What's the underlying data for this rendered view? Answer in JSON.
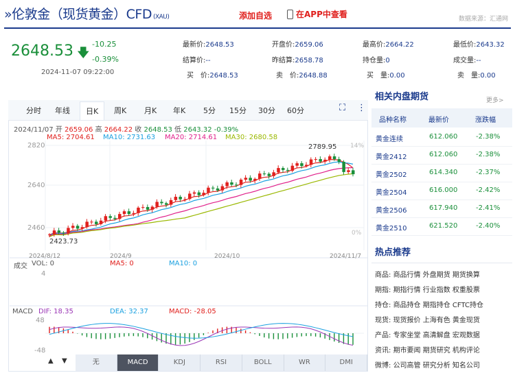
{
  "header": {
    "title": "»伦敦金（现货黄金）CFD",
    "title_suffix": "(XAU)",
    "add_favorite": "添加自选",
    "view_in_app": "在APP中查看",
    "source": "数据来源：汇通网"
  },
  "quote": {
    "price": "2648.53",
    "change": "-10.25",
    "change_pct": "-0.39%",
    "datetime": "2024-11-07 09:22:00",
    "fields": [
      {
        "label": "最新价:",
        "value": "2648.53"
      },
      {
        "label": "开盘价:",
        "value": "2659.06"
      },
      {
        "label": "最高价:",
        "value": "2664.22"
      },
      {
        "label": "最低价:",
        "value": "2643.32"
      },
      {
        "label": "结算价:",
        "value": "--"
      },
      {
        "label": "昨结算:",
        "value": "2658.78"
      },
      {
        "label": "持仓量:",
        "value": "0"
      },
      {
        "label": "成交量:",
        "value": "--"
      },
      {
        "label": "买　价:",
        "value": "2648.53"
      },
      {
        "label": "卖　价:",
        "value": "2648.88"
      },
      {
        "label": "买　量:",
        "value": "0.00"
      },
      {
        "label": "卖　量:",
        "value": "0.00"
      }
    ]
  },
  "chart_tabs": [
    "分时",
    "年线",
    "日K",
    "周K",
    "月K",
    "年K",
    "5分",
    "15分",
    "30分",
    "60分"
  ],
  "chart_info": {
    "date": "2024/11/07",
    "open_label": "开",
    "open": "2659.06",
    "high_label": "高",
    "high": "2664.22",
    "close_label": "收",
    "close": "2648.53",
    "low_label": "低",
    "low": "2643.32",
    "change_pct": "-0.39%",
    "ma5": "MA5: 2704.61",
    "ma10": "MA10: 2731.63",
    "ma20": "MA20: 2714.61",
    "ma30": "MA30: 2680.58",
    "max_label": "2789.95",
    "min_label": "2423.73",
    "y_top": "2820",
    "y_mid": "2640",
    "y_bot": "2460",
    "pct_top": "14%",
    "pct_bot": "0%",
    "x_labels": [
      "2024/8/12",
      "2024/9",
      "2024/10",
      "2024/11/7"
    ]
  },
  "volume": {
    "title": "成交",
    "vol": "VOL: 0",
    "ma5": "MA5: 0",
    "ma10": "MA10: 0",
    "ymax": "4"
  },
  "macd": {
    "title": "MACD",
    "dif": "DIF: 18.35",
    "dea": "DEA: 32.37",
    "macd": "MACD: -28.05",
    "ytop": "48",
    "ybot": "-48"
  },
  "indicators": [
    "无",
    "MACD",
    "KDJ",
    "RSI",
    "BOLL",
    "WR",
    "DMI"
  ],
  "selected_indicator": "MACD",
  "domestic": {
    "title": "相关内盘期货",
    "more": "更多>",
    "columns": [
      "品种名称",
      "最新价",
      "涨跌幅"
    ],
    "rows": [
      {
        "name": "黄金连续",
        "price": "612.060",
        "pct": "-2.38%"
      },
      {
        "name": "黄金2412",
        "price": "612.060",
        "pct": "-2.38%"
      },
      {
        "name": "黄金2502",
        "price": "614.340",
        "pct": "-2.37%"
      },
      {
        "name": "黄金2504",
        "price": "616.000",
        "pct": "-2.42%"
      },
      {
        "name": "黄金2506",
        "price": "617.940",
        "pct": "-2.41%"
      },
      {
        "name": "黄金2510",
        "price": "621.520",
        "pct": "-2.40%"
      }
    ]
  },
  "hot": {
    "title": "热点推荐",
    "rows": [
      {
        "label": "商品:",
        "links": "商品行情 外盘期货 期货换算"
      },
      {
        "label": "期指:",
        "links": "期指行情 行业指数 权重股票"
      },
      {
        "label": "持仓:",
        "links": "商品持仓 期指持仓 CFTC持仓"
      },
      {
        "label": "现货:",
        "links": "现货报价 上海有色 黄金现货"
      },
      {
        "label": "产品:",
        "links": "专家坐堂 高清解盘 宏观数据"
      },
      {
        "label": "资讯:",
        "links": "期市要闻 期货研究 机构评论"
      },
      {
        "label": "微博:",
        "links": "公司高管 研究分析 知名公司"
      }
    ]
  },
  "colors": {
    "up": "#e0201d",
    "down": "#1a8f3a",
    "ma5": "#e0201d",
    "ma10": "#1aa0e0",
    "ma20": "#e0208a",
    "ma30": "#9ab800",
    "brand": "#1a3a8c"
  }
}
